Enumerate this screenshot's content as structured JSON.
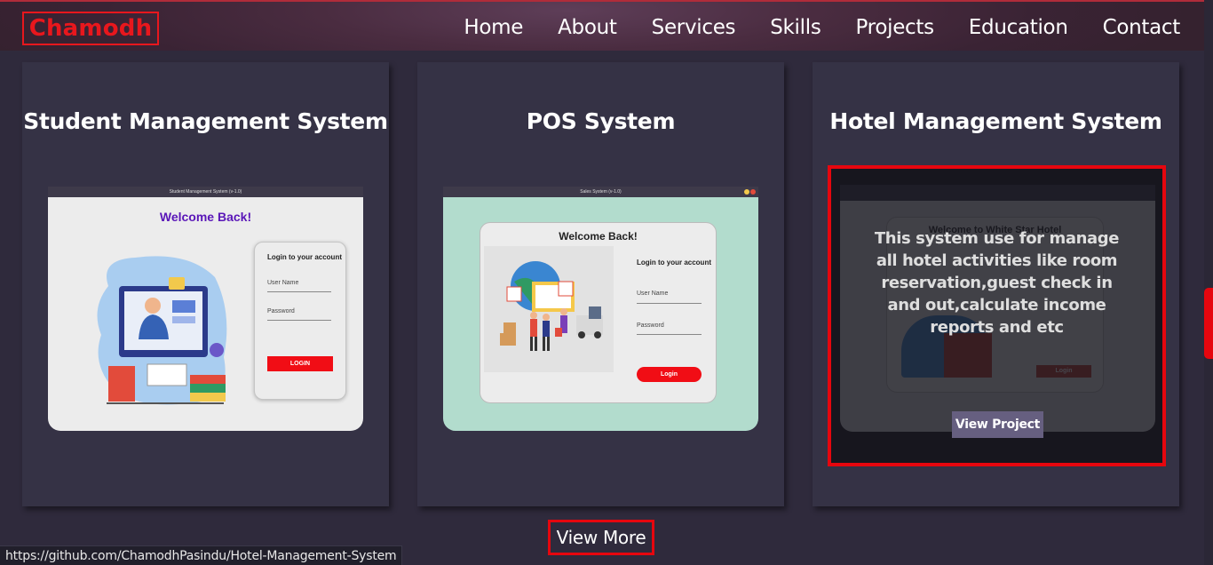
{
  "nav": {
    "brand": "Chamodh",
    "links": [
      "Home",
      "About",
      "Services",
      "Skills",
      "Projects",
      "Education",
      "Contact"
    ]
  },
  "projects": [
    {
      "title": "Student Management System",
      "screenshot": {
        "window_title": "Student Management System (v-1.0)",
        "welcome": "Welcome Back!",
        "login_heading": "Login to your account",
        "username_label": "User Name",
        "password_label": "Password",
        "button": "LOGIN"
      }
    },
    {
      "title": "POS System",
      "screenshot": {
        "window_title": "Sales System (v-1.0)",
        "welcome": "Welcome Back!",
        "login_heading": "Login to your account",
        "username_label": "User Name",
        "password_label": "Password",
        "button": "Login"
      }
    },
    {
      "title": "Hotel Management System",
      "screenshot": {
        "welcome": "Welcome to White Star Hotel",
        "button": "Login"
      },
      "description": "This system use for manage all hotel activities like room reservation,guest check in and out,calculate income reports and etc",
      "view_project": "View Project"
    }
  ],
  "view_more": "View More",
  "status_url": "https://github.com/ChamodhPasindu/Hotel-Management-System",
  "colors": {
    "accent": "#e6060e",
    "background": "#2f2a3c",
    "card": "#353245",
    "view_project_button": "#665f80"
  }
}
